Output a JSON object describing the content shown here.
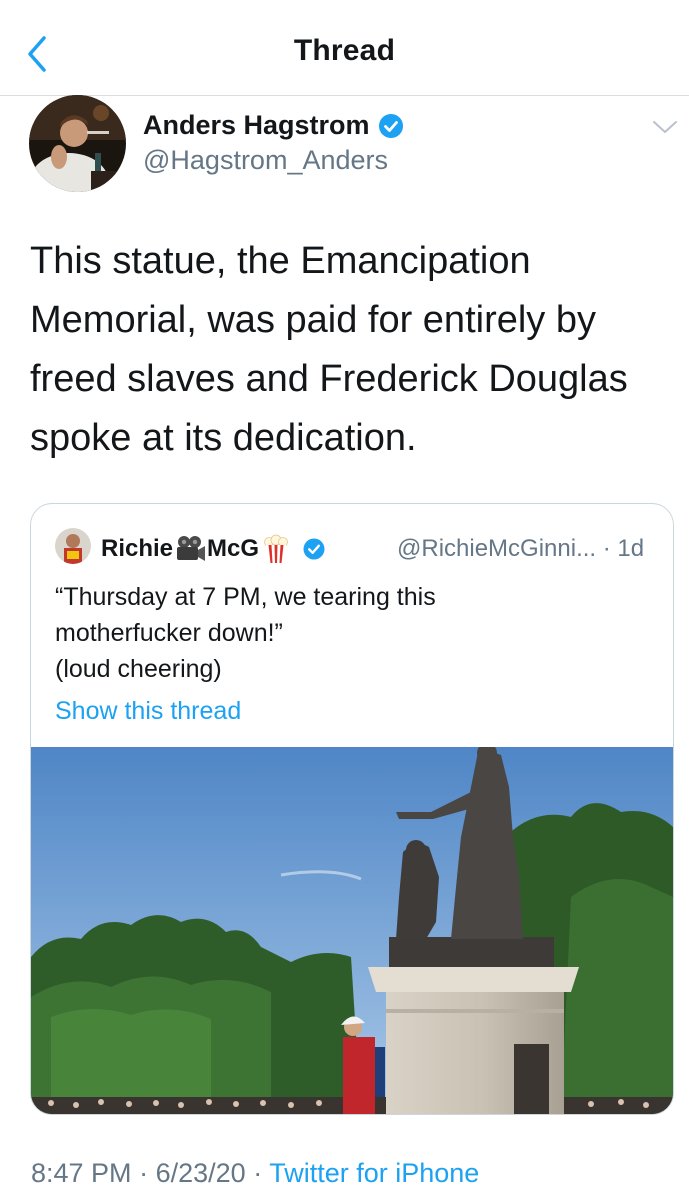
{
  "header": {
    "title": "Thread",
    "back_icon": "chevron-left-icon"
  },
  "tweet": {
    "author_name": "Anders Hagstrom",
    "author_handle": "@Hagstrom_Anders",
    "verified": true,
    "text": "This statue, the Emancipation Memorial, was paid for entirely by freed slaves and Frederick Douglas spoke at its dedication."
  },
  "quoted_tweet": {
    "name_part1": "Richie",
    "name_emoji1": "movie-camera-icon",
    "name_part2": "McG",
    "name_emoji2": "popcorn-icon",
    "verified": true,
    "handle": "@RichieMcGinni...",
    "separator": "·",
    "time": "1d",
    "text_lines": [
      "“Thursday at 7 PM, we tearing this",
      "motherfucker down!”",
      "(loud cheering)"
    ],
    "show_thread": "Show this thread"
  },
  "footer": {
    "time": "8:47 PM",
    "sep1": "·",
    "date": "6/23/20",
    "sep2": "·",
    "source": "Twitter for iPhone"
  },
  "colors": {
    "accent": "#1da1f2",
    "text": "#14171a",
    "secondary": "#657786",
    "border": "#ccd6dd"
  }
}
